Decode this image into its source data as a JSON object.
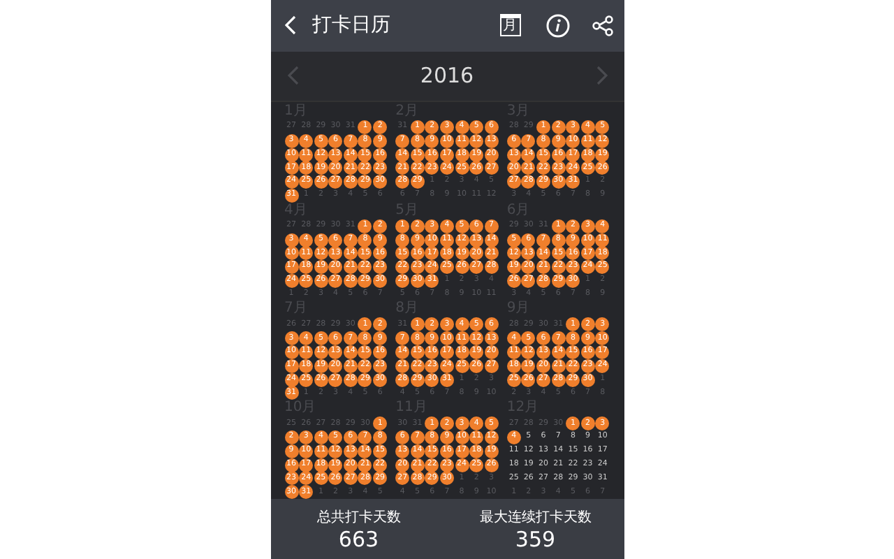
{
  "header": {
    "title": "打卡日历",
    "calendar_glyph": "月"
  },
  "year_nav": {
    "year": "2016",
    "prev_disabled": true,
    "next_disabled": true
  },
  "months": [
    {
      "label": "1月",
      "leading": [
        "27",
        "28",
        "29",
        "30",
        "31"
      ],
      "trailing": [
        "1",
        "2",
        "3",
        "4",
        "5",
        "6"
      ],
      "days": [
        {
          "n": "1",
          "checked": true
        },
        {
          "n": "2",
          "checked": true
        },
        {
          "n": "3",
          "checked": true
        },
        {
          "n": "4",
          "checked": true
        },
        {
          "n": "5",
          "checked": true
        },
        {
          "n": "6",
          "checked": true
        },
        {
          "n": "7",
          "checked": true
        },
        {
          "n": "8",
          "checked": true
        },
        {
          "n": "9",
          "checked": true
        },
        {
          "n": "10",
          "checked": true
        },
        {
          "n": "11",
          "checked": true
        },
        {
          "n": "12",
          "checked": true
        },
        {
          "n": "13",
          "checked": true
        },
        {
          "n": "14",
          "checked": true
        },
        {
          "n": "15",
          "checked": true
        },
        {
          "n": "16",
          "checked": true
        },
        {
          "n": "17",
          "checked": true
        },
        {
          "n": "18",
          "checked": true
        },
        {
          "n": "19",
          "checked": true
        },
        {
          "n": "20",
          "checked": true
        },
        {
          "n": "21",
          "checked": true
        },
        {
          "n": "22",
          "checked": true
        },
        {
          "n": "23",
          "checked": true
        },
        {
          "n": "24",
          "checked": true
        },
        {
          "n": "25",
          "checked": true
        },
        {
          "n": "26",
          "checked": true
        },
        {
          "n": "27",
          "checked": true
        },
        {
          "n": "28",
          "checked": true
        },
        {
          "n": "29",
          "checked": true
        },
        {
          "n": "30",
          "checked": true
        },
        {
          "n": "31",
          "checked": true
        }
      ]
    },
    {
      "label": "2月",
      "leading": [
        "31"
      ],
      "trailing": [
        "1",
        "2",
        "3",
        "4",
        "5",
        "6",
        "7",
        "8",
        "9",
        "10",
        "11",
        "12"
      ],
      "days": [
        {
          "n": "1",
          "checked": true
        },
        {
          "n": "2",
          "checked": true
        },
        {
          "n": "3",
          "checked": true
        },
        {
          "n": "4",
          "checked": true
        },
        {
          "n": "5",
          "checked": true
        },
        {
          "n": "6",
          "checked": true
        },
        {
          "n": "7",
          "checked": true
        },
        {
          "n": "8",
          "checked": true
        },
        {
          "n": "9",
          "checked": true
        },
        {
          "n": "10",
          "checked": true
        },
        {
          "n": "11",
          "checked": true
        },
        {
          "n": "12",
          "checked": true
        },
        {
          "n": "13",
          "checked": true
        },
        {
          "n": "14",
          "checked": true
        },
        {
          "n": "15",
          "checked": true
        },
        {
          "n": "16",
          "checked": true
        },
        {
          "n": "17",
          "checked": true
        },
        {
          "n": "18",
          "checked": true
        },
        {
          "n": "19",
          "checked": true
        },
        {
          "n": "20",
          "checked": true
        },
        {
          "n": "21",
          "checked": true
        },
        {
          "n": "22",
          "checked": true
        },
        {
          "n": "23",
          "checked": true
        },
        {
          "n": "24",
          "checked": true
        },
        {
          "n": "25",
          "checked": true
        },
        {
          "n": "26",
          "checked": true
        },
        {
          "n": "27",
          "checked": true
        },
        {
          "n": "28",
          "checked": true
        },
        {
          "n": "29",
          "checked": true
        }
      ]
    },
    {
      "label": "3月",
      "leading": [
        "28",
        "29"
      ],
      "trailing": [
        "1",
        "2",
        "3",
        "4",
        "5",
        "6",
        "7",
        "8",
        "9"
      ],
      "days": [
        {
          "n": "1",
          "checked": true
        },
        {
          "n": "2",
          "checked": true
        },
        {
          "n": "3",
          "checked": true
        },
        {
          "n": "4",
          "checked": true
        },
        {
          "n": "5",
          "checked": true
        },
        {
          "n": "6",
          "checked": true
        },
        {
          "n": "7",
          "checked": true
        },
        {
          "n": "8",
          "checked": true
        },
        {
          "n": "9",
          "checked": true
        },
        {
          "n": "10",
          "checked": true
        },
        {
          "n": "11",
          "checked": true
        },
        {
          "n": "12",
          "checked": true
        },
        {
          "n": "13",
          "checked": true
        },
        {
          "n": "14",
          "checked": true
        },
        {
          "n": "15",
          "checked": true
        },
        {
          "n": "16",
          "checked": true
        },
        {
          "n": "17",
          "checked": true
        },
        {
          "n": "18",
          "checked": true
        },
        {
          "n": "19",
          "checked": true
        },
        {
          "n": "20",
          "checked": true
        },
        {
          "n": "21",
          "checked": true
        },
        {
          "n": "22",
          "checked": true
        },
        {
          "n": "23",
          "checked": true
        },
        {
          "n": "24",
          "checked": true
        },
        {
          "n": "25",
          "checked": true
        },
        {
          "n": "26",
          "checked": true
        },
        {
          "n": "27",
          "checked": true
        },
        {
          "n": "28",
          "checked": true
        },
        {
          "n": "29",
          "checked": true
        },
        {
          "n": "30",
          "checked": true
        },
        {
          "n": "31",
          "checked": true
        }
      ]
    },
    {
      "label": "4月",
      "leading": [
        "27",
        "28",
        "29",
        "30",
        "31"
      ],
      "trailing": [
        "1",
        "2",
        "3",
        "4",
        "5",
        "6",
        "7"
      ],
      "days": [
        {
          "n": "1",
          "checked": true
        },
        {
          "n": "2",
          "checked": true
        },
        {
          "n": "3",
          "checked": true
        },
        {
          "n": "4",
          "checked": true
        },
        {
          "n": "5",
          "checked": true
        },
        {
          "n": "6",
          "checked": true
        },
        {
          "n": "7",
          "checked": true
        },
        {
          "n": "8",
          "checked": true
        },
        {
          "n": "9",
          "checked": true
        },
        {
          "n": "10",
          "checked": true
        },
        {
          "n": "11",
          "checked": true
        },
        {
          "n": "12",
          "checked": true
        },
        {
          "n": "13",
          "checked": true
        },
        {
          "n": "14",
          "checked": true
        },
        {
          "n": "15",
          "checked": true
        },
        {
          "n": "16",
          "checked": true
        },
        {
          "n": "17",
          "checked": true
        },
        {
          "n": "18",
          "checked": true
        },
        {
          "n": "19",
          "checked": true
        },
        {
          "n": "20",
          "checked": true
        },
        {
          "n": "21",
          "checked": true
        },
        {
          "n": "22",
          "checked": true
        },
        {
          "n": "23",
          "checked": true
        },
        {
          "n": "24",
          "checked": true
        },
        {
          "n": "25",
          "checked": true
        },
        {
          "n": "26",
          "checked": true
        },
        {
          "n": "27",
          "checked": true
        },
        {
          "n": "28",
          "checked": true
        },
        {
          "n": "29",
          "checked": true
        },
        {
          "n": "30",
          "checked": true
        }
      ]
    },
    {
      "label": "5月",
      "trailing": [
        "1",
        "2",
        "3",
        "4",
        "5",
        "6",
        "7",
        "8",
        "9",
        "10",
        "11"
      ],
      "days": [
        {
          "n": "1",
          "checked": true
        },
        {
          "n": "2",
          "checked": true
        },
        {
          "n": "3",
          "checked": true
        },
        {
          "n": "4",
          "checked": true
        },
        {
          "n": "5",
          "checked": true
        },
        {
          "n": "6",
          "checked": true
        },
        {
          "n": "7",
          "checked": true
        },
        {
          "n": "8",
          "checked": true
        },
        {
          "n": "9",
          "checked": true
        },
        {
          "n": "10",
          "checked": true
        },
        {
          "n": "11",
          "checked": true
        },
        {
          "n": "12",
          "checked": true
        },
        {
          "n": "13",
          "checked": true
        },
        {
          "n": "14",
          "checked": true
        },
        {
          "n": "15",
          "checked": true
        },
        {
          "n": "16",
          "checked": true
        },
        {
          "n": "17",
          "checked": true
        },
        {
          "n": "18",
          "checked": true
        },
        {
          "n": "19",
          "checked": true
        },
        {
          "n": "20",
          "checked": true
        },
        {
          "n": "21",
          "checked": true
        },
        {
          "n": "22",
          "checked": true
        },
        {
          "n": "23",
          "checked": true
        },
        {
          "n": "24",
          "checked": true
        },
        {
          "n": "25",
          "checked": true
        },
        {
          "n": "26",
          "checked": true
        },
        {
          "n": "27",
          "checked": true
        },
        {
          "n": "28",
          "checked": true
        },
        {
          "n": "29",
          "checked": true
        },
        {
          "n": "30",
          "checked": true
        },
        {
          "n": "31",
          "checked": true
        }
      ]
    },
    {
      "label": "6月",
      "leading": [
        "29",
        "30",
        "31"
      ],
      "trailing": [
        "1",
        "2",
        "3",
        "4",
        "5",
        "6",
        "7",
        "8",
        "9"
      ],
      "days": [
        {
          "n": "1",
          "checked": true
        },
        {
          "n": "2",
          "checked": true
        },
        {
          "n": "3",
          "checked": true
        },
        {
          "n": "4",
          "checked": true
        },
        {
          "n": "5",
          "checked": true
        },
        {
          "n": "6",
          "checked": true
        },
        {
          "n": "7",
          "checked": true
        },
        {
          "n": "8",
          "checked": true
        },
        {
          "n": "9",
          "checked": true
        },
        {
          "n": "10",
          "checked": true
        },
        {
          "n": "11",
          "checked": true
        },
        {
          "n": "12",
          "checked": true
        },
        {
          "n": "13",
          "checked": true
        },
        {
          "n": "14",
          "checked": true
        },
        {
          "n": "15",
          "checked": true
        },
        {
          "n": "16",
          "checked": true
        },
        {
          "n": "17",
          "checked": true
        },
        {
          "n": "18",
          "checked": true
        },
        {
          "n": "19",
          "checked": true
        },
        {
          "n": "20",
          "checked": true
        },
        {
          "n": "21",
          "checked": true
        },
        {
          "n": "22",
          "checked": true
        },
        {
          "n": "23",
          "checked": true
        },
        {
          "n": "24",
          "checked": true
        },
        {
          "n": "25",
          "checked": true
        },
        {
          "n": "26",
          "checked": true
        },
        {
          "n": "27",
          "checked": true
        },
        {
          "n": "28",
          "checked": true
        },
        {
          "n": "29",
          "checked": true
        },
        {
          "n": "30",
          "checked": true
        }
      ]
    },
    {
      "label": "7月",
      "leading": [
        "26",
        "27",
        "28",
        "29",
        "30"
      ],
      "trailing": [
        "1",
        "2",
        "3",
        "4",
        "5",
        "6"
      ],
      "days": [
        {
          "n": "1",
          "checked": true
        },
        {
          "n": "2",
          "checked": true
        },
        {
          "n": "3",
          "checked": true
        },
        {
          "n": "4",
          "checked": true
        },
        {
          "n": "5",
          "checked": true
        },
        {
          "n": "6",
          "checked": true
        },
        {
          "n": "7",
          "checked": true
        },
        {
          "n": "8",
          "checked": true
        },
        {
          "n": "9",
          "checked": true
        },
        {
          "n": "10",
          "checked": true
        },
        {
          "n": "11",
          "checked": true
        },
        {
          "n": "12",
          "checked": true
        },
        {
          "n": "13",
          "checked": true
        },
        {
          "n": "14",
          "checked": true
        },
        {
          "n": "15",
          "checked": true
        },
        {
          "n": "16",
          "checked": true
        },
        {
          "n": "17",
          "checked": true
        },
        {
          "n": "18",
          "checked": true
        },
        {
          "n": "19",
          "checked": true
        },
        {
          "n": "20",
          "checked": true
        },
        {
          "n": "21",
          "checked": true
        },
        {
          "n": "22",
          "checked": true
        },
        {
          "n": "23",
          "checked": true
        },
        {
          "n": "24",
          "checked": true
        },
        {
          "n": "25",
          "checked": true
        },
        {
          "n": "26",
          "checked": true
        },
        {
          "n": "27",
          "checked": true
        },
        {
          "n": "28",
          "checked": true
        },
        {
          "n": "29",
          "checked": true
        },
        {
          "n": "30",
          "checked": true
        },
        {
          "n": "31",
          "checked": true
        }
      ]
    },
    {
      "label": "8月",
      "leading": [
        "31"
      ],
      "trailing": [
        "1",
        "2",
        "3",
        "4",
        "5",
        "6",
        "7",
        "8",
        "9",
        "10"
      ],
      "days": [
        {
          "n": "1",
          "checked": true
        },
        {
          "n": "2",
          "checked": true
        },
        {
          "n": "3",
          "checked": true
        },
        {
          "n": "4",
          "checked": true
        },
        {
          "n": "5",
          "checked": true
        },
        {
          "n": "6",
          "checked": true
        },
        {
          "n": "7",
          "checked": true
        },
        {
          "n": "8",
          "checked": true
        },
        {
          "n": "9",
          "checked": true
        },
        {
          "n": "10",
          "checked": true
        },
        {
          "n": "11",
          "checked": true
        },
        {
          "n": "12",
          "checked": true
        },
        {
          "n": "13",
          "checked": true
        },
        {
          "n": "14",
          "checked": true
        },
        {
          "n": "15",
          "checked": true
        },
        {
          "n": "16",
          "checked": true
        },
        {
          "n": "17",
          "checked": true
        },
        {
          "n": "18",
          "checked": true
        },
        {
          "n": "19",
          "checked": true
        },
        {
          "n": "20",
          "checked": true
        },
        {
          "n": "21",
          "checked": true
        },
        {
          "n": "22",
          "checked": true
        },
        {
          "n": "23",
          "checked": true
        },
        {
          "n": "24",
          "checked": true
        },
        {
          "n": "25",
          "checked": true
        },
        {
          "n": "26",
          "checked": true
        },
        {
          "n": "27",
          "checked": true
        },
        {
          "n": "28",
          "checked": true
        },
        {
          "n": "29",
          "checked": true
        },
        {
          "n": "30",
          "checked": true
        },
        {
          "n": "31",
          "checked": true
        }
      ]
    },
    {
      "label": "9月",
      "leading": [
        "28",
        "29",
        "30",
        "31"
      ],
      "trailing": [
        "1",
        "2",
        "3",
        "4",
        "5",
        "6",
        "7",
        "8"
      ],
      "days": [
        {
          "n": "1",
          "checked": true
        },
        {
          "n": "2",
          "checked": true
        },
        {
          "n": "3",
          "checked": true
        },
        {
          "n": "4",
          "checked": true
        },
        {
          "n": "5",
          "checked": true
        },
        {
          "n": "6",
          "checked": true
        },
        {
          "n": "7",
          "checked": true
        },
        {
          "n": "8",
          "checked": true
        },
        {
          "n": "9",
          "checked": true
        },
        {
          "n": "10",
          "checked": true
        },
        {
          "n": "11",
          "checked": true
        },
        {
          "n": "12",
          "checked": true
        },
        {
          "n": "13",
          "checked": true
        },
        {
          "n": "14",
          "checked": true
        },
        {
          "n": "15",
          "checked": true
        },
        {
          "n": "16",
          "checked": true
        },
        {
          "n": "17",
          "checked": true
        },
        {
          "n": "18",
          "checked": true
        },
        {
          "n": "19",
          "checked": true
        },
        {
          "n": "20",
          "checked": true
        },
        {
          "n": "21",
          "checked": true
        },
        {
          "n": "22",
          "checked": true
        },
        {
          "n": "23",
          "checked": true
        },
        {
          "n": "24",
          "checked": true
        },
        {
          "n": "25",
          "checked": true
        },
        {
          "n": "26",
          "checked": true
        },
        {
          "n": "27",
          "checked": true
        },
        {
          "n": "28",
          "checked": true
        },
        {
          "n": "29",
          "checked": true
        },
        {
          "n": "30",
          "checked": true
        }
      ]
    },
    {
      "label": "10月",
      "leading": [
        "25",
        "26",
        "27",
        "28",
        "29",
        "30"
      ],
      "trailing": [
        "1",
        "2",
        "3",
        "4",
        "5"
      ],
      "days": [
        {
          "n": "1",
          "checked": true
        },
        {
          "n": "2",
          "checked": true
        },
        {
          "n": "3",
          "checked": true
        },
        {
          "n": "4",
          "checked": true
        },
        {
          "n": "5",
          "checked": true
        },
        {
          "n": "6",
          "checked": true
        },
        {
          "n": "7",
          "checked": true
        },
        {
          "n": "8",
          "checked": true
        },
        {
          "n": "9",
          "checked": true
        },
        {
          "n": "10",
          "checked": true
        },
        {
          "n": "11",
          "checked": true
        },
        {
          "n": "12",
          "checked": true
        },
        {
          "n": "13",
          "checked": true
        },
        {
          "n": "14",
          "checked": true
        },
        {
          "n": "15",
          "checked": true
        },
        {
          "n": "16",
          "checked": true
        },
        {
          "n": "17",
          "checked": true
        },
        {
          "n": "18",
          "checked": true
        },
        {
          "n": "19",
          "checked": true
        },
        {
          "n": "20",
          "checked": true
        },
        {
          "n": "21",
          "checked": true
        },
        {
          "n": "22",
          "checked": true
        },
        {
          "n": "23",
          "checked": true
        },
        {
          "n": "24",
          "checked": true
        },
        {
          "n": "25",
          "checked": true
        },
        {
          "n": "26",
          "checked": true
        },
        {
          "n": "27",
          "checked": true
        },
        {
          "n": "28",
          "checked": true
        },
        {
          "n": "29",
          "checked": true
        },
        {
          "n": "30",
          "checked": true
        },
        {
          "n": "31",
          "checked": true
        }
      ]
    },
    {
      "label": "11月",
      "leading": [
        "30",
        "31"
      ],
      "trailing": [
        "1",
        "2",
        "3",
        "4",
        "5",
        "6",
        "7",
        "8",
        "9",
        "10"
      ],
      "days": [
        {
          "n": "1",
          "checked": true
        },
        {
          "n": "2",
          "checked": true
        },
        {
          "n": "3",
          "checked": true
        },
        {
          "n": "4",
          "checked": true
        },
        {
          "n": "5",
          "checked": true
        },
        {
          "n": "6",
          "checked": true
        },
        {
          "n": "7",
          "checked": true
        },
        {
          "n": "8",
          "checked": true
        },
        {
          "n": "9",
          "checked": true
        },
        {
          "n": "10",
          "checked": true
        },
        {
          "n": "11",
          "checked": true
        },
        {
          "n": "12",
          "checked": true
        },
        {
          "n": "13",
          "checked": true
        },
        {
          "n": "14",
          "checked": true
        },
        {
          "n": "15",
          "checked": true
        },
        {
          "n": "16",
          "checked": true
        },
        {
          "n": "17",
          "checked": true
        },
        {
          "n": "18",
          "checked": true
        },
        {
          "n": "19",
          "checked": true
        },
        {
          "n": "20",
          "checked": true
        },
        {
          "n": "21",
          "checked": true
        },
        {
          "n": "22",
          "checked": true
        },
        {
          "n": "23",
          "checked": true
        },
        {
          "n": "24",
          "checked": true
        },
        {
          "n": "25",
          "checked": true
        },
        {
          "n": "26",
          "checked": true
        },
        {
          "n": "27",
          "checked": true
        },
        {
          "n": "28",
          "checked": true
        },
        {
          "n": "29",
          "checked": true
        },
        {
          "n": "30",
          "checked": true
        }
      ]
    },
    {
      "label": "12月",
      "leading": [
        "27",
        "28",
        "29",
        "30"
      ],
      "trailing": [
        "1",
        "2",
        "3",
        "4",
        "5",
        "6",
        "7"
      ],
      "days": [
        {
          "n": "1",
          "checked": true
        },
        {
          "n": "2",
          "checked": true
        },
        {
          "n": "3",
          "checked": true
        },
        {
          "n": "4",
          "checked": true
        },
        {
          "n": "5",
          "checked": false
        },
        {
          "n": "6",
          "checked": false
        },
        {
          "n": "7",
          "checked": false
        },
        {
          "n": "8",
          "checked": false
        },
        {
          "n": "9",
          "checked": false
        },
        {
          "n": "10",
          "checked": false
        },
        {
          "n": "11",
          "checked": false
        },
        {
          "n": "12",
          "checked": false
        },
        {
          "n": "13",
          "checked": false
        },
        {
          "n": "14",
          "checked": false
        },
        {
          "n": "15",
          "checked": false
        },
        {
          "n": "16",
          "checked": false
        },
        {
          "n": "17",
          "checked": false
        },
        {
          "n": "18",
          "checked": false
        },
        {
          "n": "19",
          "checked": false
        },
        {
          "n": "20",
          "checked": false
        },
        {
          "n": "21",
          "checked": false
        },
        {
          "n": "22",
          "checked": false
        },
        {
          "n": "23",
          "checked": false
        },
        {
          "n": "24",
          "checked": false
        },
        {
          "n": "25",
          "checked": false
        },
        {
          "n": "26",
          "checked": false
        },
        {
          "n": "27",
          "checked": false
        },
        {
          "n": "28",
          "checked": false
        },
        {
          "n": "29",
          "checked": false
        },
        {
          "n": "30",
          "checked": false
        },
        {
          "n": "31",
          "checked": false
        }
      ]
    }
  ],
  "stats": [
    {
      "label": "总共打卡天数",
      "value": "663"
    },
    {
      "label": "最大连续打卡天数",
      "value": "359"
    }
  ]
}
